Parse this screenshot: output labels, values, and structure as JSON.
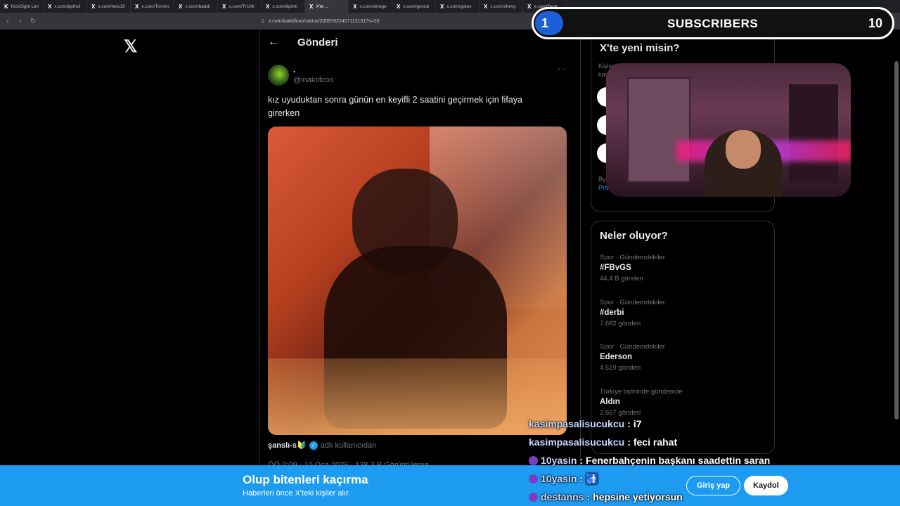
{
  "browser": {
    "tabs": [
      {
        "icon": "K",
        "label": "KickSight Lini"
      },
      {
        "icon": "X",
        "label": "x.com/bpthol"
      },
      {
        "icon": "X",
        "label": "x.com/heis19"
      },
      {
        "icon": "X",
        "label": "x.com/Tomrro"
      },
      {
        "icon": "X",
        "label": "x.com/baddi"
      },
      {
        "icon": "X",
        "label": "x.com/TrUnli"
      },
      {
        "icon": "X",
        "label": "x.com/liptinti"
      },
      {
        "icon": "X",
        "label": "X'te ..."
      },
      {
        "icon": "X",
        "label": "x.com/siirege"
      },
      {
        "icon": "X",
        "label": "x.com/gecub"
      },
      {
        "icon": "X",
        "label": "x.com/gotes"
      },
      {
        "icon": "X",
        "label": "x.com/shevy"
      },
      {
        "icon": "X",
        "label": "x.com/ifetat"
      }
    ],
    "url": "x.com/inaktifcoo/status/2009762240711315​1?s=20"
  },
  "post": {
    "header_title": "Gönderi",
    "display_name": ".",
    "handle": "@inaktifcoo",
    "text": "kız uyuduktan sonra günün en keyifli 2 saatini geçirmek için fifaya girerken",
    "credit_name": "şanslı-s🔰",
    "credit_sub": "adlı kullanıcıdan",
    "meta": "ÖÖ 2:09 · 10 Oca 2026 · 138,3 B Görüntüleme"
  },
  "sidebar": {
    "new_title": "X'te yeni misin?",
    "new_sub": "Kişisel kav",
    "by_text": "By",
    "priv_text": "Priv",
    "trends_title": "Neler oluyor?",
    "trends": [
      {
        "category": "Spor · Gündemdekiler",
        "name": "#FBvGS",
        "count": "44,4 B gönderi"
      },
      {
        "category": "Spor · Gündemdekiler",
        "name": "#derbi",
        "count": "7.682 gönderi"
      },
      {
        "category": "Spor · Gündemdekiler",
        "name": "Ederson",
        "count": "4.519 gönderi"
      },
      {
        "category": "Türkiye tarihinde gündemde",
        "name": "Aldın",
        "count": "2.557 gönderi"
      }
    ]
  },
  "overlay": {
    "subscribers_current": "1",
    "subscribers_label": "SUBSCRIBERS",
    "subscribers_goal": "10"
  },
  "chat": [
    {
      "user": "kasimpasalisucukcu",
      "sep": ":",
      "message": "i7",
      "badge": false
    },
    {
      "user": "kasimpasalisucukcu",
      "sep": ":",
      "message": "feci rahat",
      "badge": false
    },
    {
      "user": "10yasin",
      "sep": ":",
      "message": "Fenerbahçenin başkanı saadettin saran",
      "badge": true
    },
    {
      "user": "10yasin",
      "sep": ":",
      "message": "🚮",
      "badge": true
    },
    {
      "user": "destanns",
      "sep": ":",
      "message": "hepsine yetiyorsun",
      "badge": true
    }
  ],
  "banner": {
    "title": "Olup bitenleri kaçırma",
    "subtitle": "Haberleri önce X'teki kişiler alır.",
    "login_label": "Giriş yap",
    "signup_label": "Kaydol"
  }
}
